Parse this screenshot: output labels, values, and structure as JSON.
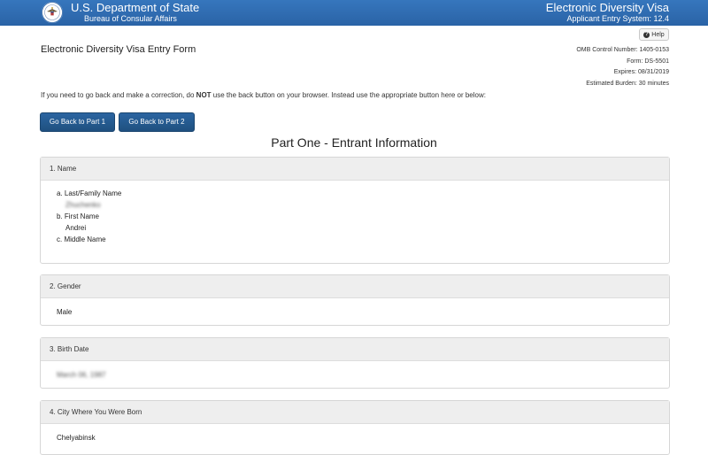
{
  "header": {
    "department": "U.S. Department of State",
    "bureau": "Bureau of Consular Affairs",
    "system_title": "Electronic Diversity Visa",
    "system_version": "Applicant Entry System: 12.4"
  },
  "help": {
    "label": "Help"
  },
  "form": {
    "title": "Electronic Diversity Visa Entry Form",
    "omb": "OMB Control Number: 1405-0153",
    "form_no": "Form: DS-5501",
    "expires": "Expires: 08/31/2019",
    "burden": "Estimated Burden: 30 minutes"
  },
  "instruction": {
    "before": "If you need to go back and make a correction, do ",
    "emphasis": "NOT",
    "after": " use the back button on your browser. Instead use the appropriate button here or below:"
  },
  "buttons": {
    "part1": "Go Back to Part 1",
    "part2": "Go Back to Part 2"
  },
  "part_title": "Part One - Entrant Information",
  "sections": {
    "name": {
      "heading": "1. Name",
      "last_label": "a. Last/Family Name",
      "last_value": "Zhuchenko",
      "first_label": "b. First Name",
      "first_value": "Andrei",
      "middle_label": "c. Middle Name"
    },
    "gender": {
      "heading": "2. Gender",
      "value": "Male"
    },
    "birth": {
      "heading": "3. Birth Date",
      "value": "March 06, 1987"
    },
    "city": {
      "heading": "4. City Where You Were Born",
      "value": "Chelyabinsk"
    }
  }
}
